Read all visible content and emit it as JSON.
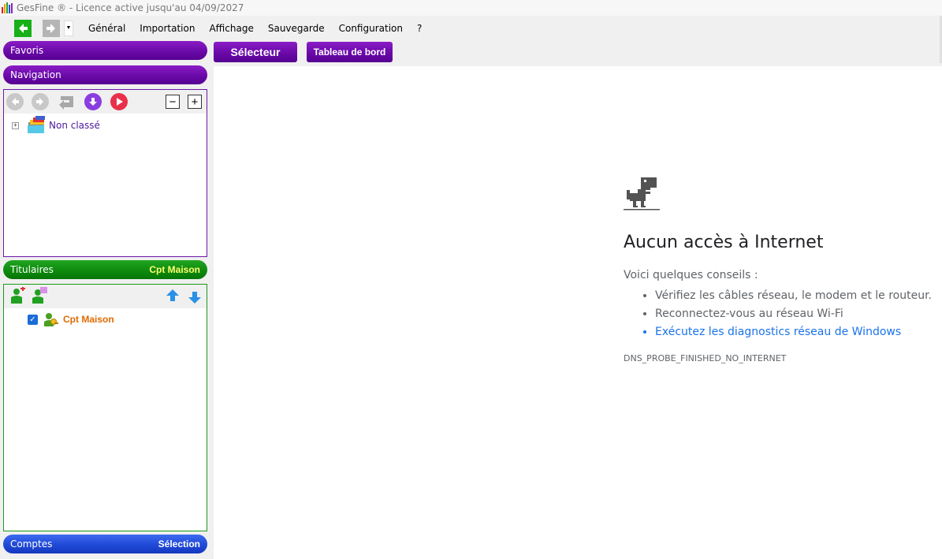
{
  "window": {
    "title": "GesFine ® - Licence active jusqu'au 04/09/2027"
  },
  "menu": {
    "items": [
      "Général",
      "Importation",
      "Affichage",
      "Sauvegarde",
      "Configuration",
      "?"
    ]
  },
  "sidebar": {
    "favoris_label": "Favoris",
    "navigation_label": "Navigation",
    "tree": [
      {
        "label": "Non classé",
        "expander": "+"
      }
    ],
    "titulaires_label": "Titulaires",
    "titulaires_current": "Cpt Maison",
    "titulaires_items": [
      {
        "label": "Cpt Maison",
        "checked": true
      }
    ],
    "comptes_label": "Comptes",
    "comptes_current": "Sélection"
  },
  "tabs": {
    "selecteur": "Sélecteur",
    "tableau_de_bord": "Tableau de bord"
  },
  "browser_error": {
    "icon": "dino-icon",
    "title": "Aucun accès à Internet",
    "subtitle": "Voici quelques conseils :",
    "tips": [
      "Vérifiez les câbles réseau, le modem et le routeur.",
      "Reconnectez-vous au réseau Wi-Fi",
      "Exécutez les diagnostics réseau de Windows"
    ],
    "code": "DNS_PROBE_FINISHED_NO_INTERNET"
  },
  "colors": {
    "purple": "#6a0aa8",
    "green": "#0e8a0e",
    "blue": "#1f49d6",
    "link": "#1a73e8"
  }
}
